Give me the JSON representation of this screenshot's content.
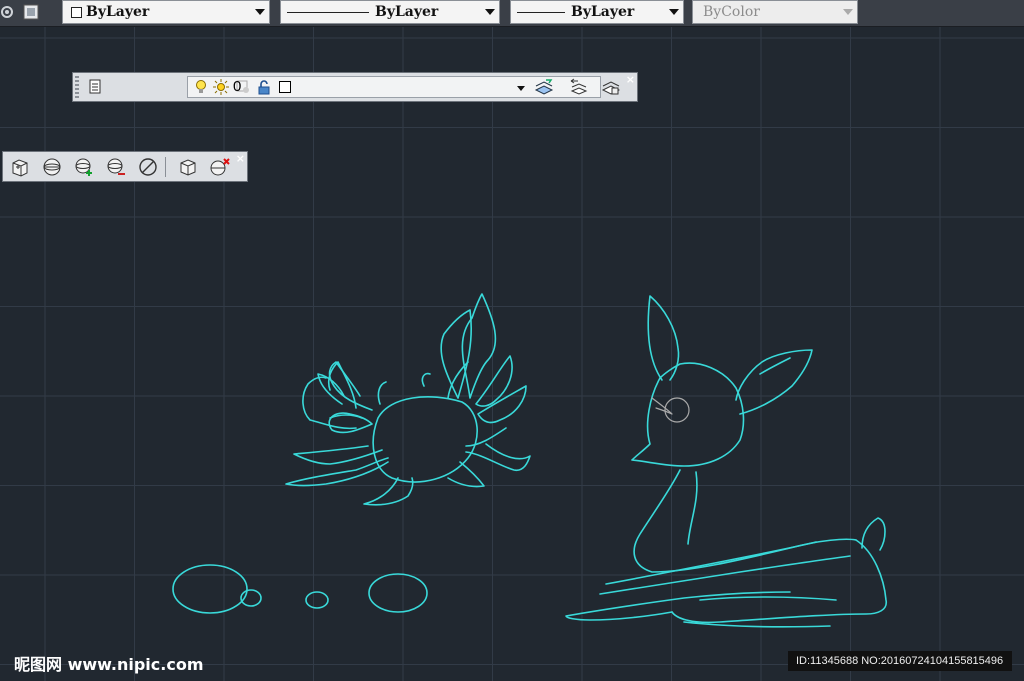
{
  "properties_toolbar": {
    "color_value": "ByLayer",
    "linetype_value": "ByLayer",
    "lineweight_value": "ByLayer",
    "plotstyle_value": "ByColor"
  },
  "layers_toolbar": {
    "current_layer": "0",
    "icons": [
      "layer-properties-icon",
      "lightbulb-on-icon",
      "sun-thaw-icon",
      "viewport-freeze-icon",
      "unlock-icon",
      "color-swatch-icon",
      "make-current-icon",
      "previous-layer-icon",
      "layer-states-icon"
    ]
  },
  "view_toolbar": {
    "icons": [
      "3d-box-icon",
      "sphere-icon",
      "sphere-add-icon",
      "sphere-subtract-icon",
      "no-entry-icon",
      "cube-icon",
      "erase-solid-icon"
    ]
  },
  "colors": {
    "background": "#212830",
    "grid": "#323b47",
    "drawing": "#39d9d9",
    "eye": "#a9a9a9"
  },
  "watermark": {
    "brand": "昵图网 www.nipic.com",
    "id_text": "ID:11345688 NO:20160724104155815496"
  }
}
